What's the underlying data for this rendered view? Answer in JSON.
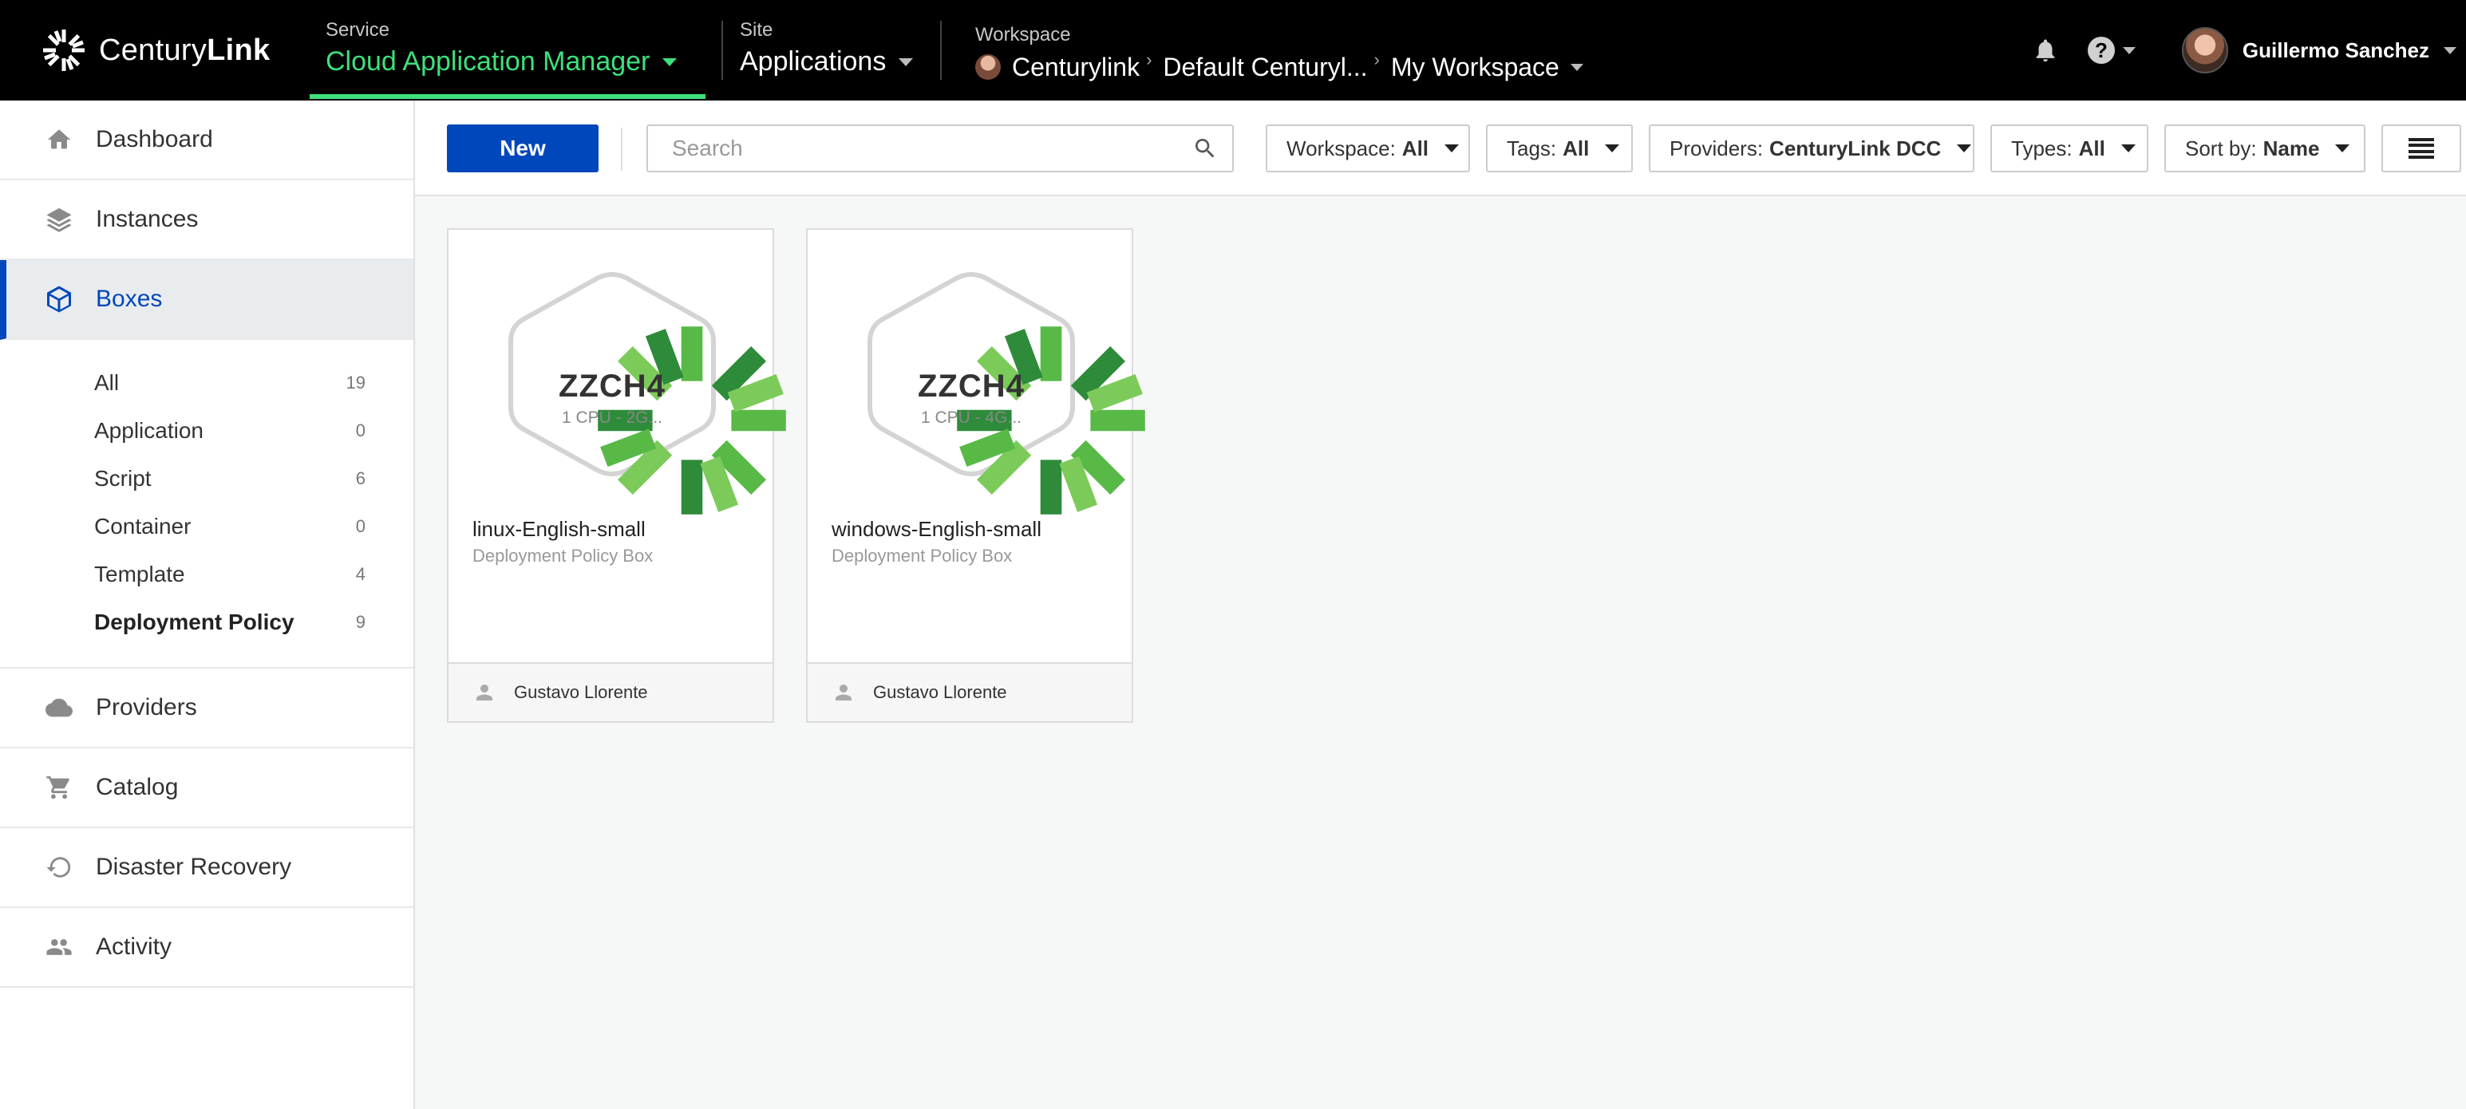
{
  "brand": {
    "name_light": "Century",
    "name_bold": "Link"
  },
  "header": {
    "service": {
      "label": "Service",
      "value": "Cloud Application Manager"
    },
    "site": {
      "label": "Site",
      "value": "Applications"
    },
    "workspace": {
      "label": "Workspace",
      "path": [
        "Centurylink",
        "Default Centuryl...",
        "My Workspace"
      ]
    },
    "user": {
      "name": "Guillermo Sanchez"
    },
    "icons": {
      "notifications": "bell-icon",
      "help": "help-icon"
    },
    "help_glyph": "?",
    "chevron_glyph": "›"
  },
  "sidebar": {
    "items_top": [
      {
        "label": "Dashboard",
        "icon": "home-icon"
      },
      {
        "label": "Instances",
        "icon": "layers-icon"
      },
      {
        "label": "Boxes",
        "icon": "box-icon",
        "active": true
      }
    ],
    "sub_items": [
      {
        "label": "All",
        "count": "19"
      },
      {
        "label": "Application",
        "count": "0"
      },
      {
        "label": "Script",
        "count": "6"
      },
      {
        "label": "Container",
        "count": "0"
      },
      {
        "label": "Template",
        "count": "4"
      },
      {
        "label": "Deployment Policy",
        "count": "9",
        "selected": true
      }
    ],
    "items_bottom": [
      {
        "label": "Providers",
        "icon": "cloud-icon"
      },
      {
        "label": "Catalog",
        "icon": "cart-icon"
      },
      {
        "label": "Disaster Recovery",
        "icon": "undo-icon"
      },
      {
        "label": "Activity",
        "icon": "people-icon"
      }
    ]
  },
  "toolbar": {
    "new_label": "New",
    "search_placeholder": "Search",
    "filters": {
      "workspace": {
        "label": "Workspace:",
        "value": "All"
      },
      "tags": {
        "label": "Tags:",
        "value": "All"
      },
      "providers": {
        "label": "Providers:",
        "value": "CenturyLink DCC"
      },
      "types": {
        "label": "Types:",
        "value": "All"
      },
      "sort": {
        "label": "Sort by:",
        "value": "Name"
      }
    }
  },
  "boxes": [
    {
      "badge_title": "ZZCH4",
      "badge_sub": "1 CPU - 2G...",
      "name": "linux-English-small",
      "kind": "Deployment Policy Box",
      "owner": "Gustavo Llorente"
    },
    {
      "badge_title": "ZZCH4",
      "badge_sub": "1 CPU - 4G...",
      "name": "windows-English-small",
      "kind": "Deployment Policy Box",
      "owner": "Gustavo Llorente"
    }
  ],
  "colors": {
    "accent_blue": "#0047bb",
    "service_green": "#3ee07c",
    "topbar": "#000000"
  }
}
